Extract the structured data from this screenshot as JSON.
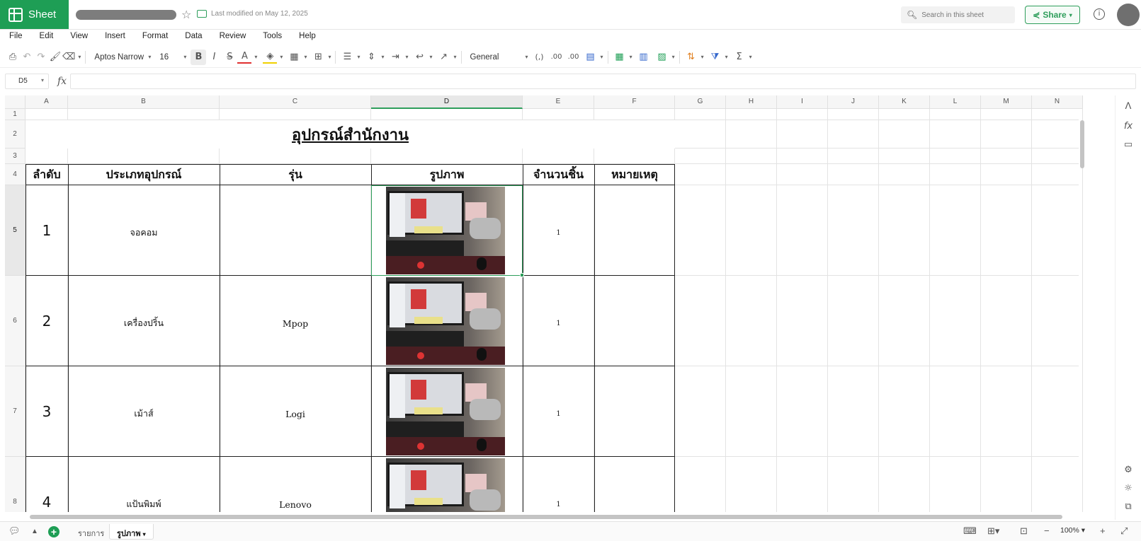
{
  "app": {
    "name": "Sheet",
    "last_modified": "Last modified on May 12, 2025",
    "search_placeholder": "Search in this sheet",
    "share_label": "Share"
  },
  "menu": [
    "File",
    "Edit",
    "View",
    "Insert",
    "Format",
    "Data",
    "Review",
    "Tools",
    "Help"
  ],
  "toolbar": {
    "font_name": "Aptos Narrow",
    "font_size": "16",
    "number_format": "General",
    "decimal_inc": ".00",
    "decimal_dec": ".00",
    "comma_style": "(,)"
  },
  "formula_bar": {
    "cell_ref": "D5",
    "fx": "fx",
    "formula": ""
  },
  "columns": [
    "A",
    "B",
    "C",
    "D",
    "E",
    "F",
    "G",
    "H",
    "I",
    "J",
    "K",
    "L",
    "M",
    "N"
  ],
  "rows": [
    "1",
    "2",
    "3",
    "4",
    "5",
    "6",
    "7",
    "8"
  ],
  "sheet": {
    "title": "อุปกรณ์สำนักงาน",
    "headers": [
      "ลำดับ",
      "ประเภทอุปกรณ์",
      "รุ่น",
      "รูปภาพ",
      "จำนวนชิ้น",
      "หมายเหตุ"
    ],
    "data_rows": [
      {
        "no": "1",
        "type": "จอคอม",
        "model": "",
        "qty": "1",
        "note": ""
      },
      {
        "no": "2",
        "type": "เครื่องปริ้น",
        "model": "Mpop",
        "qty": "1",
        "note": ""
      },
      {
        "no": "3",
        "type": "เม้าส์",
        "model": "Logi",
        "qty": "1",
        "note": ""
      },
      {
        "no": "4",
        "type": "แป้นพิมพ์",
        "model": "Lenovo",
        "qty": "1",
        "note": ""
      }
    ]
  },
  "tabs": [
    {
      "label": "รายการ",
      "active": false
    },
    {
      "label": "รูปภาพ",
      "active": true
    }
  ],
  "zoom": "100%",
  "colors": {
    "brand": "#1e9e55",
    "selection": "#2e9e5b"
  }
}
